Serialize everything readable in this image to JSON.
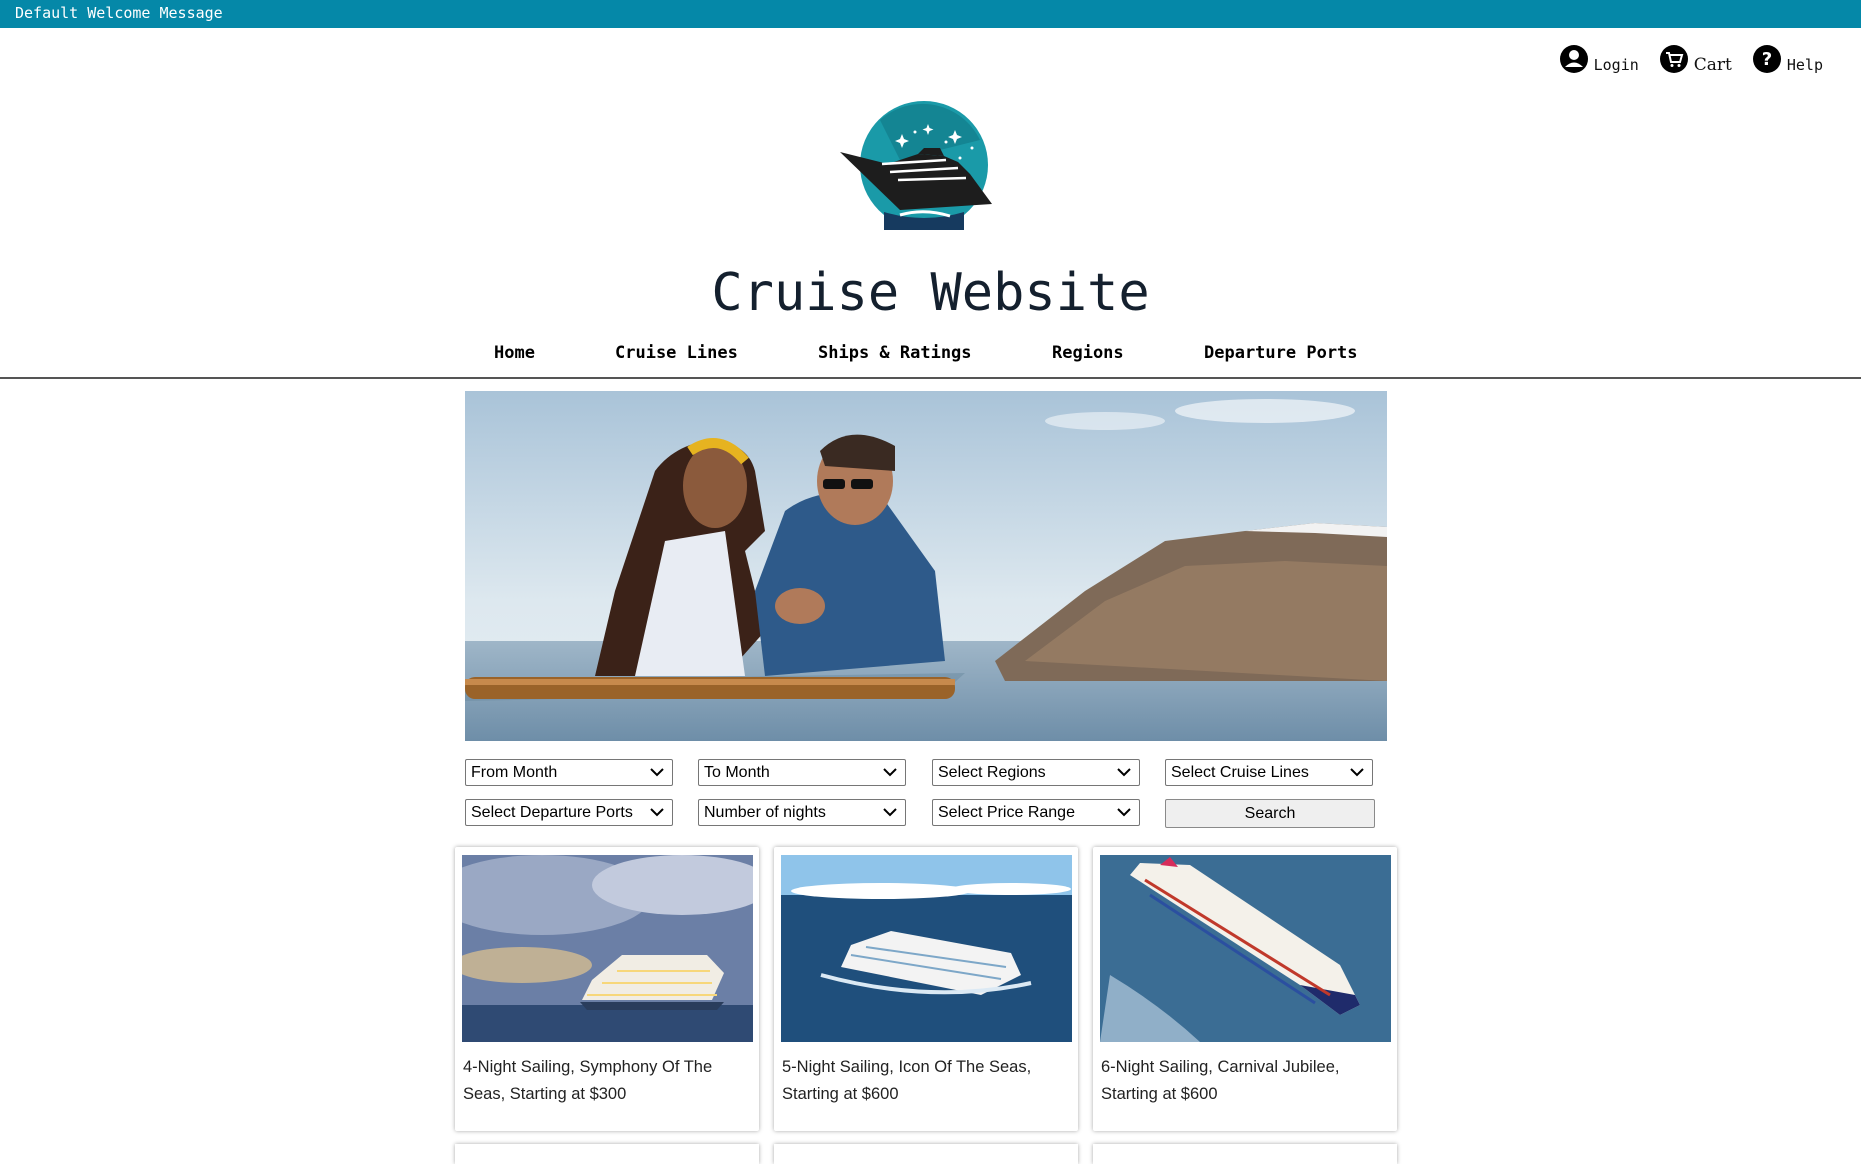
{
  "welcome": "Default Welcome Message",
  "site_title": "Cruise Website",
  "utility": {
    "login": "Login",
    "cart": "Cart",
    "help": "Help"
  },
  "nav": {
    "items": [
      "Home",
      "Cruise Lines",
      "Ships & Ratings",
      "Regions",
      "Departure Ports"
    ]
  },
  "filters": {
    "from_month": "From Month",
    "to_month": "To Month",
    "regions": "Select Regions",
    "cruise_lines": "Select Cruise Lines",
    "departure_ports": "Select Departure Ports",
    "nights": "Number of nights",
    "price_range": "Select Price Range",
    "search": "Search"
  },
  "cards": [
    {
      "text": "4-Night Sailing, Symphony Of The Seas, Starting at $300"
    },
    {
      "text": "5-Night Sailing, Icon Of The Seas, Starting at $600"
    },
    {
      "text": "6-Night Sailing, Carnival Jubilee, Starting at $600"
    }
  ],
  "colors": {
    "top_bar": "#0588a8",
    "title": "#14202e",
    "logo_teal": "#1a9aa8",
    "logo_navy": "#163a5f"
  }
}
